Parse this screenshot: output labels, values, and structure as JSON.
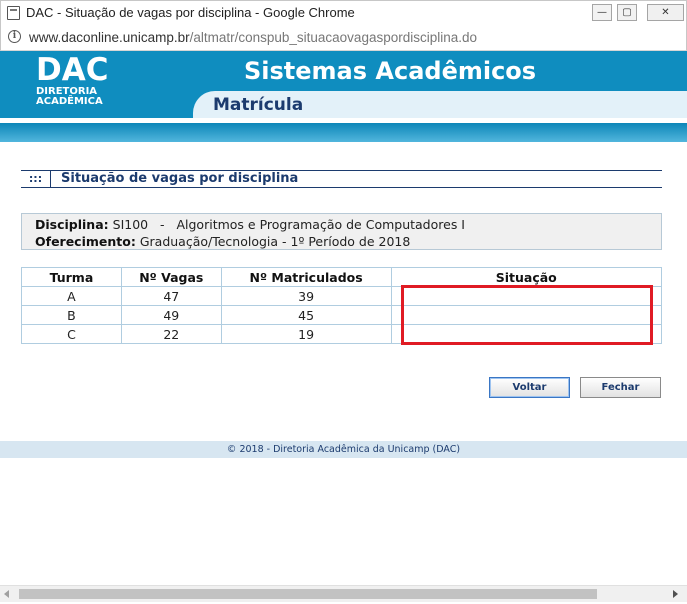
{
  "window": {
    "title": "DAC - Situação de vagas por disciplina - Google Chrome",
    "min_label": "—",
    "max_label": "▢",
    "close_label": "✕"
  },
  "address": {
    "host": "www.daconline.unicamp.br",
    "path": "/altmatr/conspub_situacaovagaspordisciplina.do"
  },
  "header": {
    "logo_big": "DAC",
    "logo_line1": "DIRETORIA",
    "logo_line2": "ACADÊMICA",
    "system_title": "Sistemas Acadêmicos",
    "module": "Matrícula"
  },
  "section": {
    "marker": ":::",
    "title": "Situação de vagas por disciplina"
  },
  "info": {
    "disciplina_label": "Disciplina:",
    "disciplina_value": "SI100   -   Algoritmos e Programação de Computadores I",
    "oferecimento_label": "Oferecimento:",
    "oferecimento_value": "Graduação/Tecnologia - 1º Período de 2018"
  },
  "table": {
    "headers": [
      "Turma",
      "Nº Vagas",
      "Nº Matriculados",
      "Situação"
    ],
    "rows": [
      [
        "A",
        "47",
        "39",
        ""
      ],
      [
        "B",
        "49",
        "45",
        ""
      ],
      [
        "C",
        "22",
        "19",
        ""
      ]
    ]
  },
  "buttons": {
    "voltar": "Voltar",
    "fechar": "Fechar"
  },
  "footer": {
    "text": "© 2018 - Diretoria Acadêmica da Unicamp (DAC)"
  },
  "colors": {
    "header_blue": "#0f8dbf",
    "navy": "#1c3b6e",
    "highlight_red": "#e01b24"
  }
}
